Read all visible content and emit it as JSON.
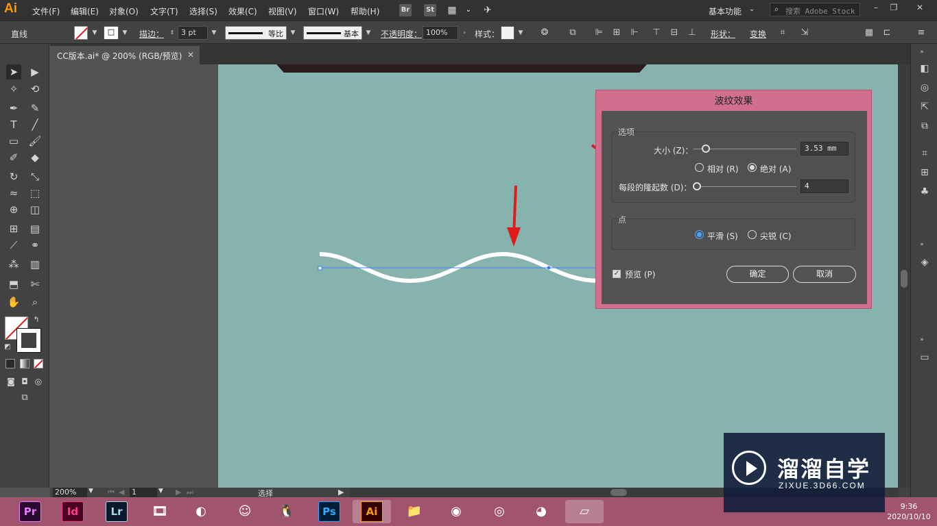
{
  "app": {
    "logo": "Ai",
    "menus": [
      "文件(F)",
      "编辑(E)",
      "对象(O)",
      "文字(T)",
      "选择(S)",
      "效果(C)",
      "视图(V)",
      "窗口(W)",
      "帮助(H)"
    ],
    "bridge_label": "Br",
    "stock_label": "St",
    "workspace": "基本功能",
    "search_placeholder": "搜索 Adobe Stock"
  },
  "controlbar": {
    "selection_type": "直线",
    "stroke_label": "描边：",
    "stroke_weight": "3 pt",
    "profile_label": "等比",
    "brush_label": "基本",
    "opacity_label": "不透明度：",
    "opacity_value": "100%",
    "style_label": "样式：",
    "shape_label": "形状：",
    "transform_label": "变换"
  },
  "document": {
    "tab_title": "CC版本.ai* @ 200% (RGB/预览)",
    "close": "✕"
  },
  "statusbar": {
    "zoom": "200%",
    "artboard": "1",
    "tool": "选择"
  },
  "dialog": {
    "title": "波纹效果",
    "options_group": "选项",
    "size_label": "大小 (Z)：",
    "size_value": "3.53 mm",
    "size_fraction": 0.12,
    "relative_label": "相对 (R)",
    "absolute_label": "绝对 (A)",
    "ridges_label": "每段的隆起数 (D)：",
    "ridges_value": "4",
    "ridges_fraction": 0.03,
    "points_group": "点",
    "smooth_label": "平滑 (S)",
    "corner_label": "尖锐 (C)",
    "preview_label": "预览 (P)",
    "ok_label": "确定",
    "cancel_label": "取消"
  },
  "watermark": {
    "cn": "溜溜自学",
    "en": "ZIXUE.3D66.COM"
  },
  "taskbar": {
    "apps": [
      "Pr",
      "Id",
      "Lr",
      "Ps",
      "Ai"
    ],
    "time": "9:36",
    "date": "2020/10/10"
  },
  "colors": {
    "artboard": "#86b3ae",
    "dialog_frame": "#d36f8e",
    "taskbar": "#a1546d",
    "arrow": "#e01b1b",
    "radio_selected": "#4aa3ff"
  }
}
